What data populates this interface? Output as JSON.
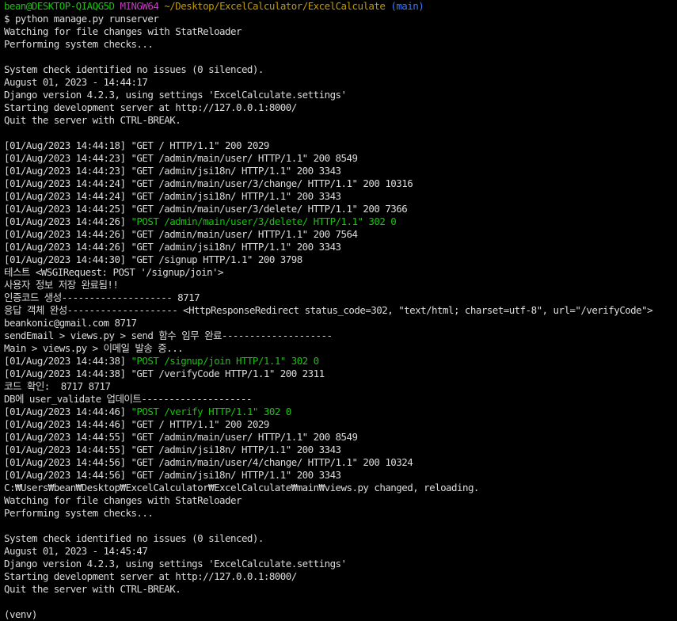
{
  "terminal": {
    "prompt": {
      "user_host": "bean@DESKTOP-QIAQG5D",
      "env": "MINGW64",
      "path": "~/Desktop/ExcelCalculator/ExcelCalculate",
      "branch": "(main)"
    },
    "command_line": "$ python manage.py runserver",
    "lines": [
      "Watching for file changes with StatReloader",
      "Performing system checks...",
      "",
      "System check identified no issues (0 silenced).",
      "August 01, 2023 - 14:44:17",
      "Django version 4.2.3, using settings 'ExcelCalculate.settings'",
      "Starting development server at http://127.0.0.1:8000/",
      "Quit the server with CTRL-BREAK.",
      "",
      "[01/Aug/2023 14:44:18] \"GET / HTTP/1.1\" 200 2029",
      "[01/Aug/2023 14:44:23] \"GET /admin/main/user/ HTTP/1.1\" 200 8549",
      "[01/Aug/2023 14:44:23] \"GET /admin/jsi18n/ HTTP/1.1\" 200 3343",
      "[01/Aug/2023 14:44:24] \"GET /admin/main/user/3/change/ HTTP/1.1\" 200 10316",
      "[01/Aug/2023 14:44:24] \"GET /admin/jsi18n/ HTTP/1.1\" 200 3343",
      "[01/Aug/2023 14:44:25] \"GET /admin/main/user/3/delete/ HTTP/1.1\" 200 7366"
    ],
    "line_post_delete": {
      "prefix": "[01/Aug/2023 14:44:26] ",
      "request": "\"POST /admin/main/user/3/delete/ HTTP/1.1\" 302 0"
    },
    "lines_2": [
      "[01/Aug/2023 14:44:26] \"GET /admin/main/user/ HTTP/1.1\" 200 7564",
      "[01/Aug/2023 14:44:26] \"GET /admin/jsi18n/ HTTP/1.1\" 200 3343",
      "[01/Aug/2023 14:44:30] \"GET /signup HTTP/1.1\" 200 3798",
      "테스트 <WSGIRequest: POST '/signup/join'>",
      "사용자 정보 저장 완료됨!!",
      "인증코드 생성-------------------- 8717",
      "응답 객체 완성-------------------- <HttpResponseRedirect status_code=302, \"text/html; charset=utf-8\", url=\"/verifyCode\">",
      "beankonic@gmail.com 8717",
      "sendEmail > views.py > send 함수 임무 완료--------------------",
      "Main > views.py > 이메일 발송 중..."
    ],
    "line_post_join": {
      "prefix": "[01/Aug/2023 14:44:38] ",
      "request": "\"POST /signup/join HTTP/1.1\" 302 0"
    },
    "lines_3": [
      "[01/Aug/2023 14:44:38] \"GET /verifyCode HTTP/1.1\" 200 2311",
      "코드 확인:  8717 8717",
      "DB에 user_validate 업데이트--------------------"
    ],
    "line_post_verify": {
      "prefix": "[01/Aug/2023 14:44:46] ",
      "request": "\"POST /verify HTTP/1.1\" 302 0"
    },
    "lines_4": [
      "[01/Aug/2023 14:44:46] \"GET / HTTP/1.1\" 200 2029",
      "[01/Aug/2023 14:44:55] \"GET /admin/main/user/ HTTP/1.1\" 200 8549",
      "[01/Aug/2023 14:44:55] \"GET /admin/jsi18n/ HTTP/1.1\" 200 3343",
      "[01/Aug/2023 14:44:56] \"GET /admin/main/user/4/change/ HTTP/1.1\" 200 10324",
      "[01/Aug/2023 14:44:56] \"GET /admin/jsi18n/ HTTP/1.1\" 200 3343",
      "C:₩Users₩bean₩Desktop₩ExcelCalculator₩ExcelCalculate₩main₩views.py changed, reloading.",
      "Watching for file changes with StatReloader",
      "Performing system checks...",
      "",
      "System check identified no issues (0 silenced).",
      "August 01, 2023 - 14:45:47",
      "Django version 4.2.3, using settings 'ExcelCalculate.settings'",
      "Starting development server at http://127.0.0.1:8000/",
      "Quit the server with CTRL-BREAK.",
      "",
      "(venv)"
    ],
    "colors": {
      "background": "#000000",
      "text": "#dcdcdc",
      "user_host": "#16c60c",
      "env": "#c839c5",
      "path": "#c19c00",
      "branch": "#3b78ff",
      "post_request": "#16c60c"
    }
  }
}
